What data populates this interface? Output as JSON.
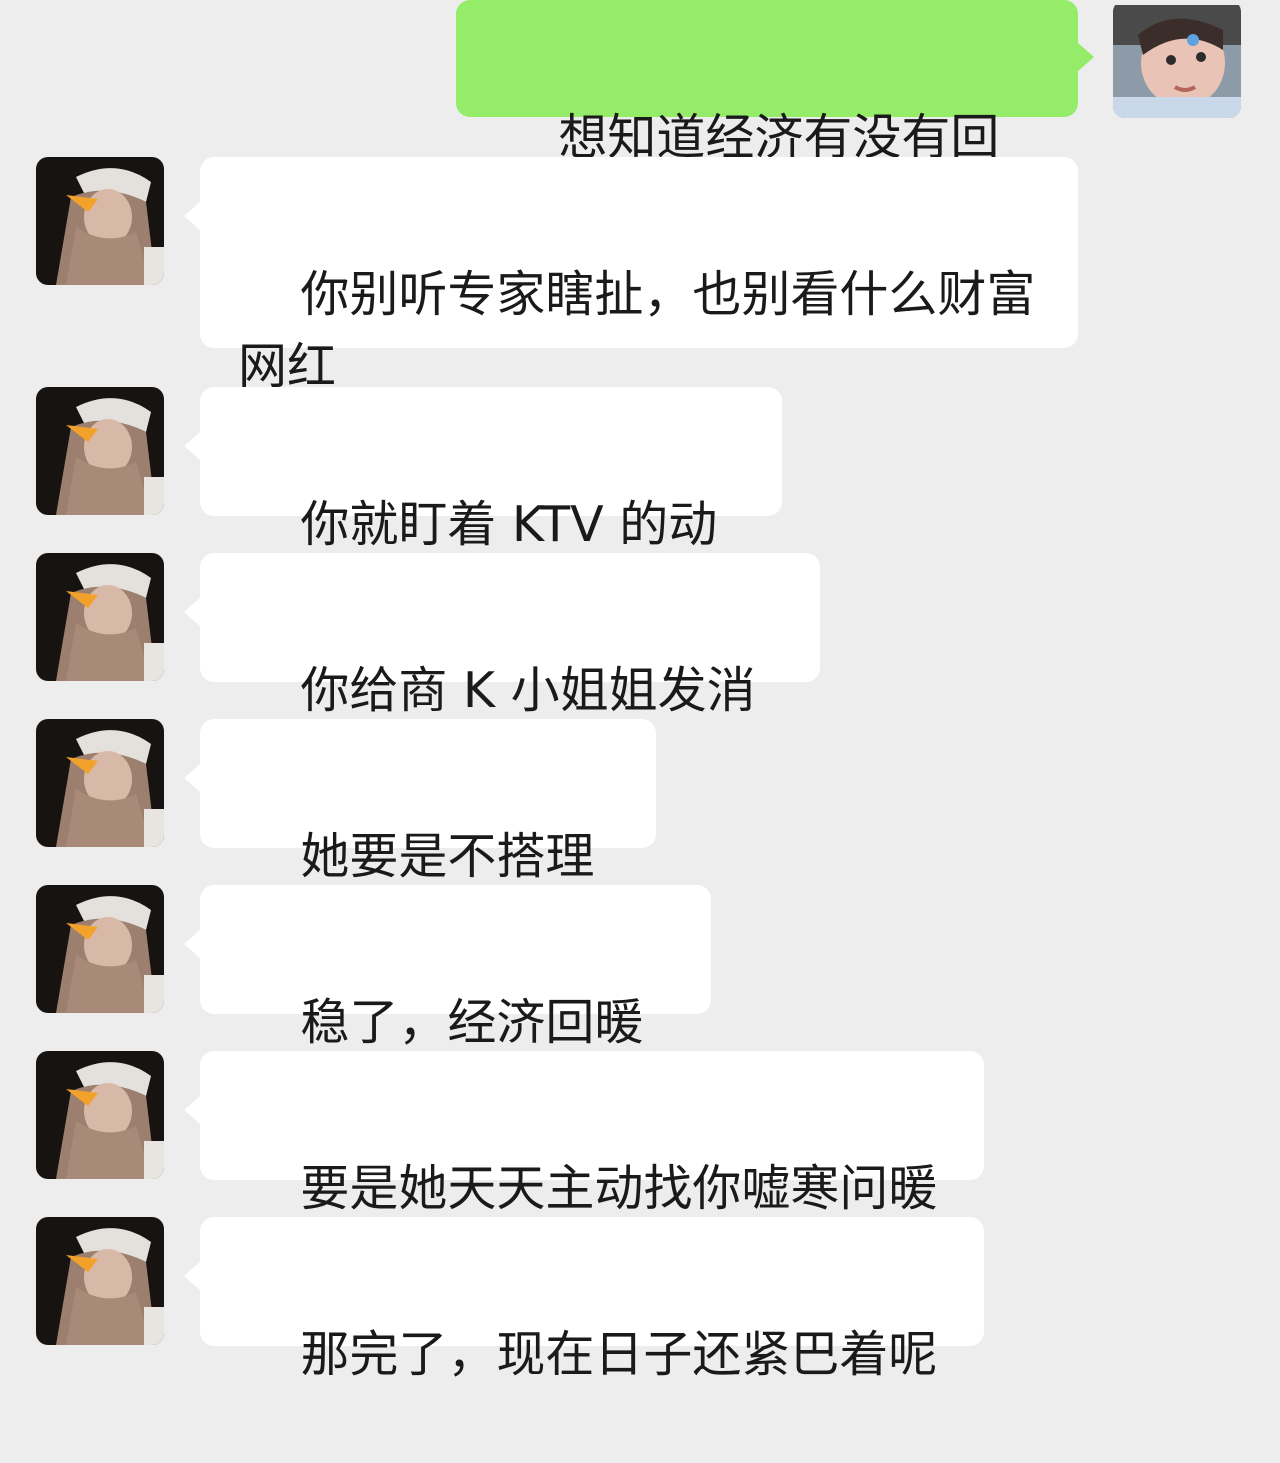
{
  "conversation": {
    "sent": {
      "text": "想知道经济有没有回暖",
      "avatar_icon": "child-avatar-icon"
    },
    "received_avatar_icon": "woman-long-hair-avatar-icon",
    "received": [
      {
        "text": "你别听专家瞎扯，也别看什么财富网红"
      },
      {
        "text": "你就盯着 KTV 的动静"
      },
      {
        "text": "你给商 K 小姐姐发消息"
      },
      {
        "text": "她要是不搭理你"
      },
      {
        "text": "稳了，经济回暖了"
      },
      {
        "text": "要是她天天主动找你嘘寒问暖"
      },
      {
        "text": "那完了，现在日子还紧巴着呢"
      }
    ]
  },
  "colors": {
    "background": "#ededed",
    "sent_bubble": "#95ec69",
    "received_bubble": "#ffffff",
    "text": "#1a1a1a"
  }
}
